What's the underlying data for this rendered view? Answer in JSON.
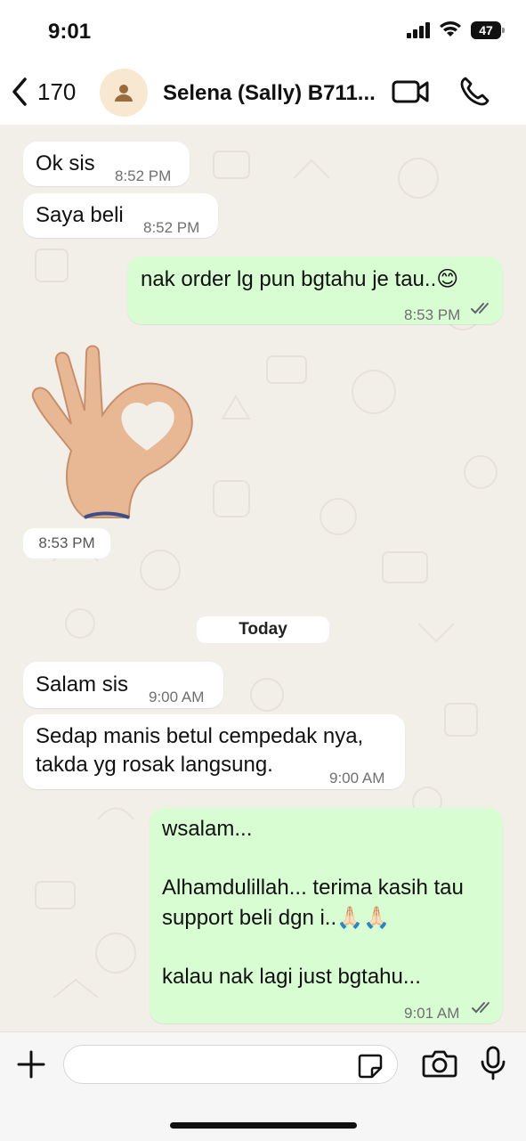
{
  "status_bar": {
    "time": "9:01",
    "battery": "47"
  },
  "header": {
    "back_count": "170",
    "contact_name": "Selena (Sally) B711..."
  },
  "messages": [
    {
      "text": "Ok sis",
      "time": "8:52 PM"
    },
    {
      "text": "Saya beli",
      "time": "8:52 PM"
    },
    {
      "text": "nak order lg pun bgtahu je tau..😊",
      "time": "8:53 PM"
    },
    {
      "time": "8:53 PM"
    },
    {
      "text": "Salam sis",
      "time": "9:00 AM"
    },
    {
      "line1": "Sedap manis betul cempedak nya,",
      "line2": "takda yg rosak langsung.",
      "time": "9:00 AM"
    },
    {
      "line1": "wsalam...",
      "line2": "Alhamdulillah... terima kasih tau",
      "line3": "support beli dgn i..🙏🏻🙏🏻",
      "line4": "kalau nak lagi just bgtahu...",
      "time": "9:01 AM"
    }
  ],
  "date_divider": "Today",
  "input": {
    "placeholder": ""
  },
  "colors": {
    "incoming_bubble": "#ffffff",
    "outgoing_bubble": "#d9fdd3",
    "read_ticks": "#5f6368",
    "wallpaper": "#f2efe9"
  }
}
